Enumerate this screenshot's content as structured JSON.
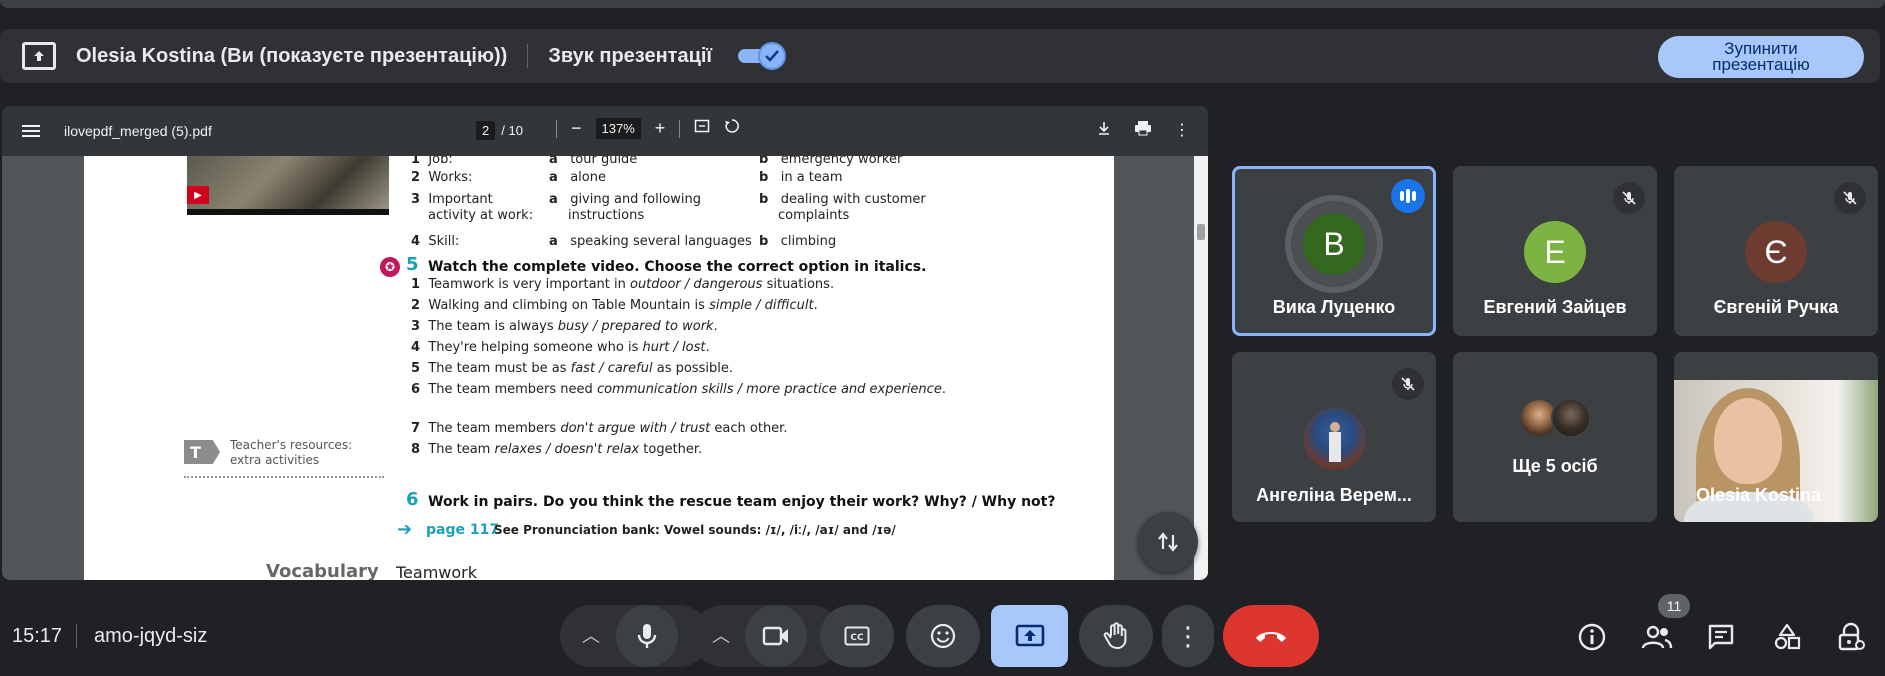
{
  "share_bar": {
    "presenter_text": "Olesia Kostina (Ви (показуєте презентацію))",
    "audio_label": "Звук презентації",
    "audio_enabled": true,
    "stop_button": "Зупинити презентацію"
  },
  "pdf_viewer": {
    "filename": "ilovepdf_merged (5).pdf",
    "current_page": "2",
    "total_pages": "/ 10",
    "zoom": "137%"
  },
  "document": {
    "ex4_rows": [
      {
        "num": "1",
        "label": "Job:",
        "a": "tour guide",
        "b": "emergency worker"
      },
      {
        "num": "2",
        "label": "Works:",
        "a": "alone",
        "b": "in a team"
      },
      {
        "num": "3",
        "label": "Important",
        "label2": "activity at work:",
        "a": "giving and following",
        "a2": "instructions",
        "b": "dealing with customer",
        "b2": "complaints"
      },
      {
        "num": "4",
        "label": "Skill:",
        "a": "speaking several languages",
        "b": "climbing"
      }
    ],
    "letter_a": "a",
    "letter_b": "b",
    "ex5_num": "5",
    "ex5_title": "Watch the complete video. Choose the correct option in italics.",
    "ex5_items": [
      {
        "num": "1",
        "pre": "Teamwork is very important in ",
        "opt": "outdoor / dangerous",
        "post": " situations."
      },
      {
        "num": "2",
        "pre": "Walking and climbing on Table Mountain is ",
        "opt": "simple / difficult",
        "post": "."
      },
      {
        "num": "3",
        "pre": "The team is always ",
        "opt": "busy / prepared to work",
        "post": "."
      },
      {
        "num": "4",
        "pre": "They're helping someone who is ",
        "opt": "hurt / lost",
        "post": "."
      },
      {
        "num": "5",
        "pre": "The team must be as ",
        "opt": "fast / careful",
        "post": " as possible."
      },
      {
        "num": "6",
        "pre": "The team members need ",
        "opt": "communication skills / more practice and experience",
        "post": "."
      },
      {
        "num": "7",
        "pre": "The team members ",
        "opt": "don't argue with / trust",
        "post": " each other."
      },
      {
        "num": "8",
        "pre": "The team ",
        "opt": "relaxes / doesn't relax",
        "post": " together."
      }
    ],
    "teacher_badge": "T",
    "teacher_line1": "Teacher's resources:",
    "teacher_line2": "extra activities",
    "ex6_num": "6",
    "ex6_title": "Work in pairs. Do you think the rescue team enjoy their work? Why? / Why not?",
    "page_link": "page 117",
    "pron_text": "See Pronunciation bank: Vowel sounds: /ɪ/, /iː/, /aɪ/ and /ɪə/",
    "vocab_heading": "Vocabulary",
    "vocab_topic": "Teamwork"
  },
  "participants": [
    {
      "name": "Вика Луценко",
      "initial": "В",
      "color": "#33691e",
      "state": "speaking"
    },
    {
      "name": "Евгений Зайцев",
      "initial": "Е",
      "color": "#7cb342",
      "state": "muted"
    },
    {
      "name": "Євгеній Ручка",
      "initial": "Є",
      "color": "#6d3b30",
      "state": "muted"
    },
    {
      "name": "Ангеліна Верем...",
      "state": "muted"
    },
    {
      "name": "Ще 5 осіб"
    },
    {
      "name": "Olesia Kostina"
    }
  ],
  "bottom_bar": {
    "time": "15:17",
    "meeting_code": "amo-jqyd-siz",
    "participant_count": "11"
  },
  "colors": {
    "background": "#202124",
    "accent": "#8ab4f8",
    "hangup": "#dc362e",
    "present": "#a8c7fa"
  }
}
